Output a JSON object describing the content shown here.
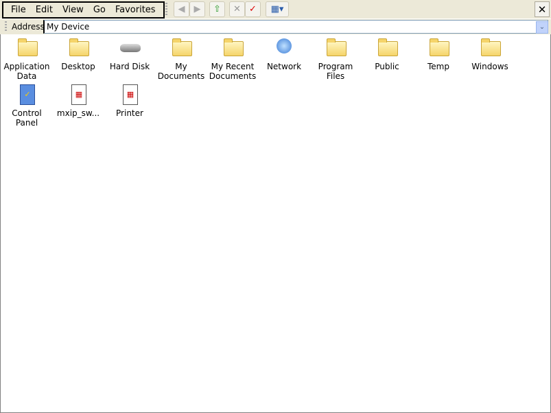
{
  "menu": [
    "File",
    "Edit",
    "View",
    "Go",
    "Favorites"
  ],
  "toolbar": {
    "back": "◀",
    "forward": "▶",
    "up": "⇧",
    "delete": "✕",
    "properties": "✓",
    "views": "▦▾",
    "close": "✕"
  },
  "address": {
    "label": "Address",
    "value": "My Device",
    "dropdown": "⌄"
  },
  "items": [
    {
      "label": "Application Data",
      "icon": "folder-icon"
    },
    {
      "label": "Desktop",
      "icon": "folder-icon"
    },
    {
      "label": "Hard Disk",
      "icon": "hard-disk-icon"
    },
    {
      "label": "My Documents",
      "icon": "folder-icon"
    },
    {
      "label": "My Recent Documents",
      "icon": "folder-icon"
    },
    {
      "label": "Network",
      "icon": "network-icon"
    },
    {
      "label": "Program Files",
      "icon": "folder-icon"
    },
    {
      "label": "Public",
      "icon": "folder-icon"
    },
    {
      "label": "Temp",
      "icon": "folder-icon"
    },
    {
      "label": "Windows",
      "icon": "folder-icon"
    },
    {
      "label": "Control Panel",
      "icon": "control-panel-shortcut-icon"
    },
    {
      "label": "mxip_sw...",
      "icon": "executable-icon"
    },
    {
      "label": "Printer",
      "icon": "executable-icon"
    }
  ]
}
